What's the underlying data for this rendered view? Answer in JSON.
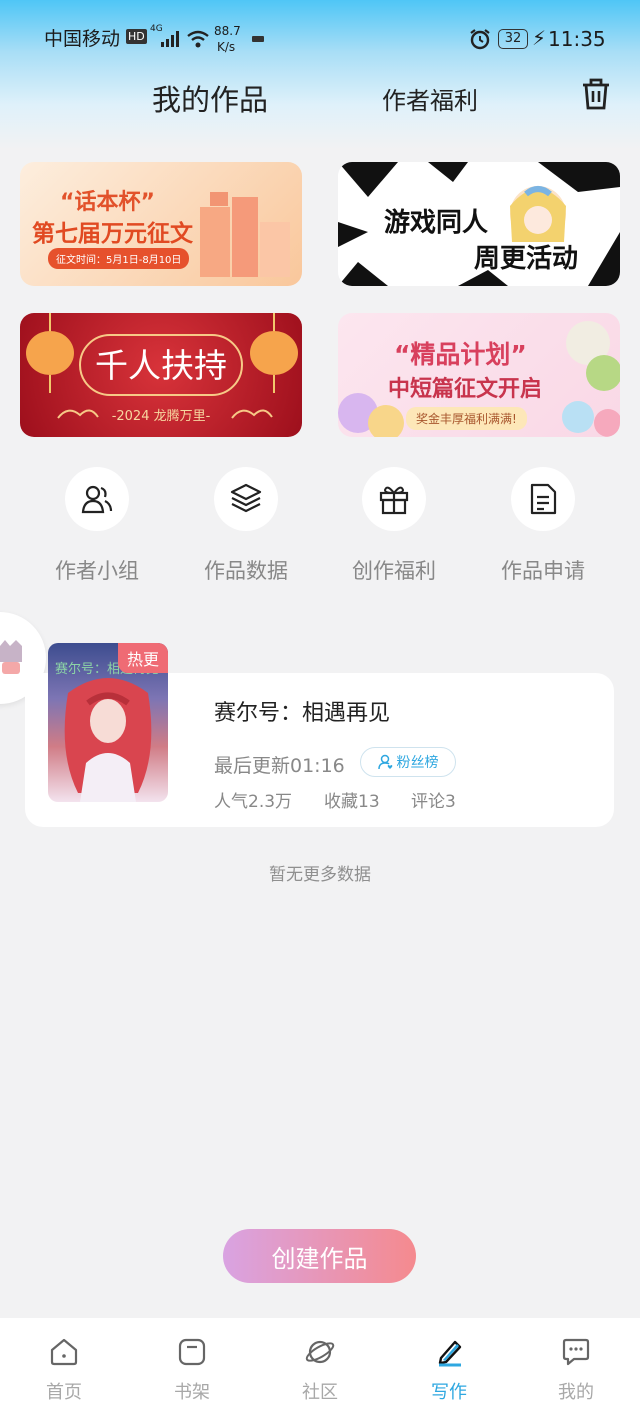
{
  "status_bar": {
    "carrier": "中国移动",
    "hd": "HD",
    "network": "4G",
    "speed_value": "88.7",
    "speed_unit": "K/s",
    "battery": "32",
    "time": "11:35"
  },
  "header": {
    "tab_works": "我的作品",
    "tab_welfare": "作者福利"
  },
  "banners": {
    "b1": {
      "line1": "“话本杯”",
      "line2": "第七届万元征文",
      "line3": "征文时间：5月1日-8月10日"
    },
    "b2": {
      "line1": "游戏同人",
      "line2": "周更活动"
    },
    "b3": {
      "line1": "千人扶持",
      "line2": "-2024 龙腾万里-"
    },
    "b4": {
      "line1": "“精品计划”",
      "line2": "中短篇征文开启",
      "line3": "奖金丰厚福利满满!"
    }
  },
  "quick_actions": [
    {
      "label": "作者小组",
      "icon": "users-icon"
    },
    {
      "label": "作品数据",
      "icon": "layers-icon"
    },
    {
      "label": "创作福利",
      "icon": "gift-icon"
    },
    {
      "label": "作品申请",
      "icon": "document-icon"
    }
  ],
  "work": {
    "hot_badge": "热更",
    "cover_text": "赛尔号：相遇再见",
    "title": "赛尔号：相遇再见",
    "updated": "最后更新01:16",
    "fan_rank": "粉丝榜",
    "popularity": "人气2.3万",
    "collections": "收藏13",
    "comments": "评论3"
  },
  "no_more": "暂无更多数据",
  "create_button": "创建作品",
  "bottom_nav": [
    {
      "label": "首页",
      "icon": "home-icon",
      "active": false
    },
    {
      "label": "书架",
      "icon": "bookshelf-icon",
      "active": false
    },
    {
      "label": "社区",
      "icon": "planet-icon",
      "active": false
    },
    {
      "label": "写作",
      "icon": "pen-icon",
      "active": true
    },
    {
      "label": "我的",
      "icon": "chat-bubble-icon",
      "active": false
    }
  ],
  "colors": {
    "accent": "#2ea7e0",
    "hot": "#ef6b74",
    "create_from": "#d9a3e2",
    "create_to": "#f58a8e"
  }
}
